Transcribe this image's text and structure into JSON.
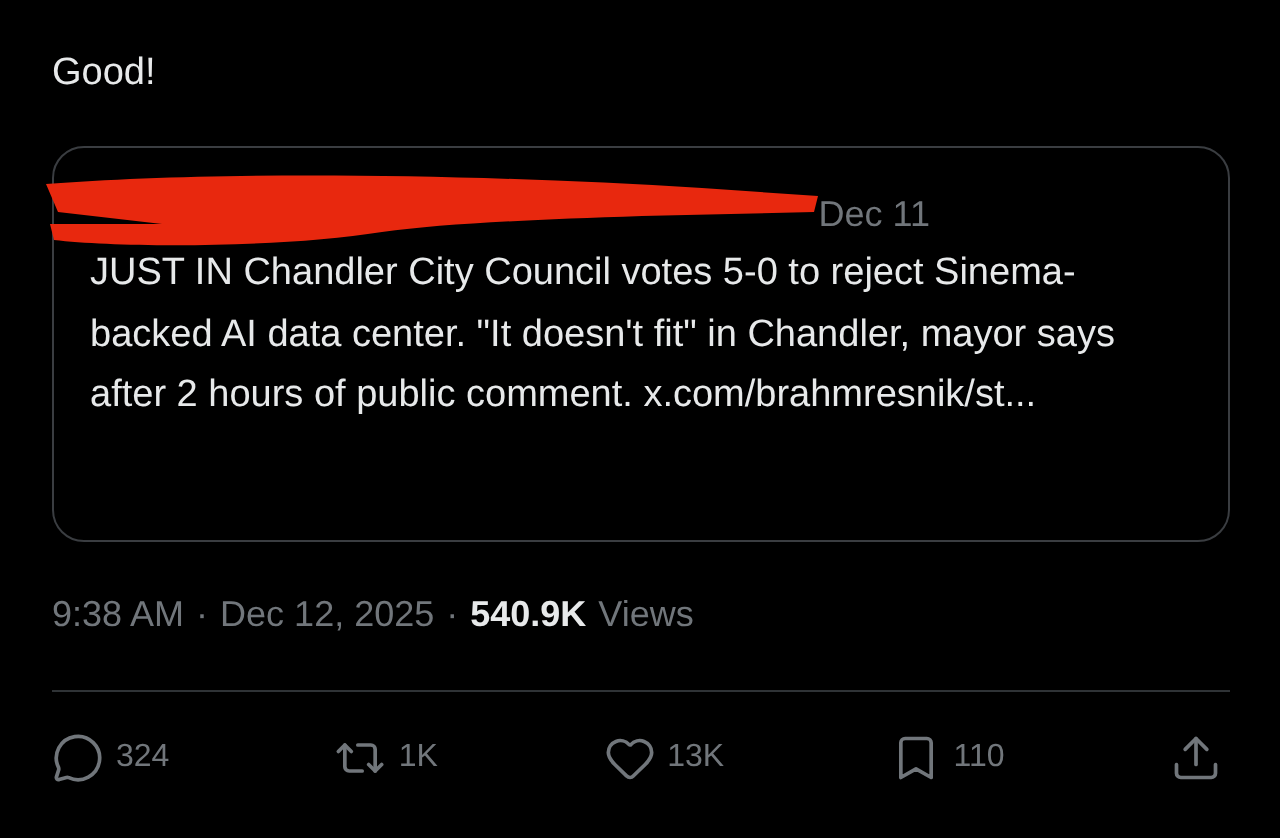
{
  "post": {
    "text": "Good!"
  },
  "quote": {
    "date": "Dec 11",
    "text": "JUST IN Chandler City Council votes 5-0 to reject Sinema-backed AI data center. \"It doesn't fit\" in Chandler, mayor says after 2 hours of public comment. x.com/brahmresnik/st..."
  },
  "meta": {
    "time": "9:38 AM",
    "separator": "·",
    "date": "Dec 12, 2025",
    "views_count": "540.9K",
    "views_label": "Views"
  },
  "actions": [
    {
      "kind": "reply",
      "count": "324"
    },
    {
      "kind": "repost",
      "count": "1K"
    },
    {
      "kind": "like",
      "count": "13K"
    },
    {
      "kind": "bookmark",
      "count": "110"
    },
    {
      "kind": "share"
    }
  ]
}
